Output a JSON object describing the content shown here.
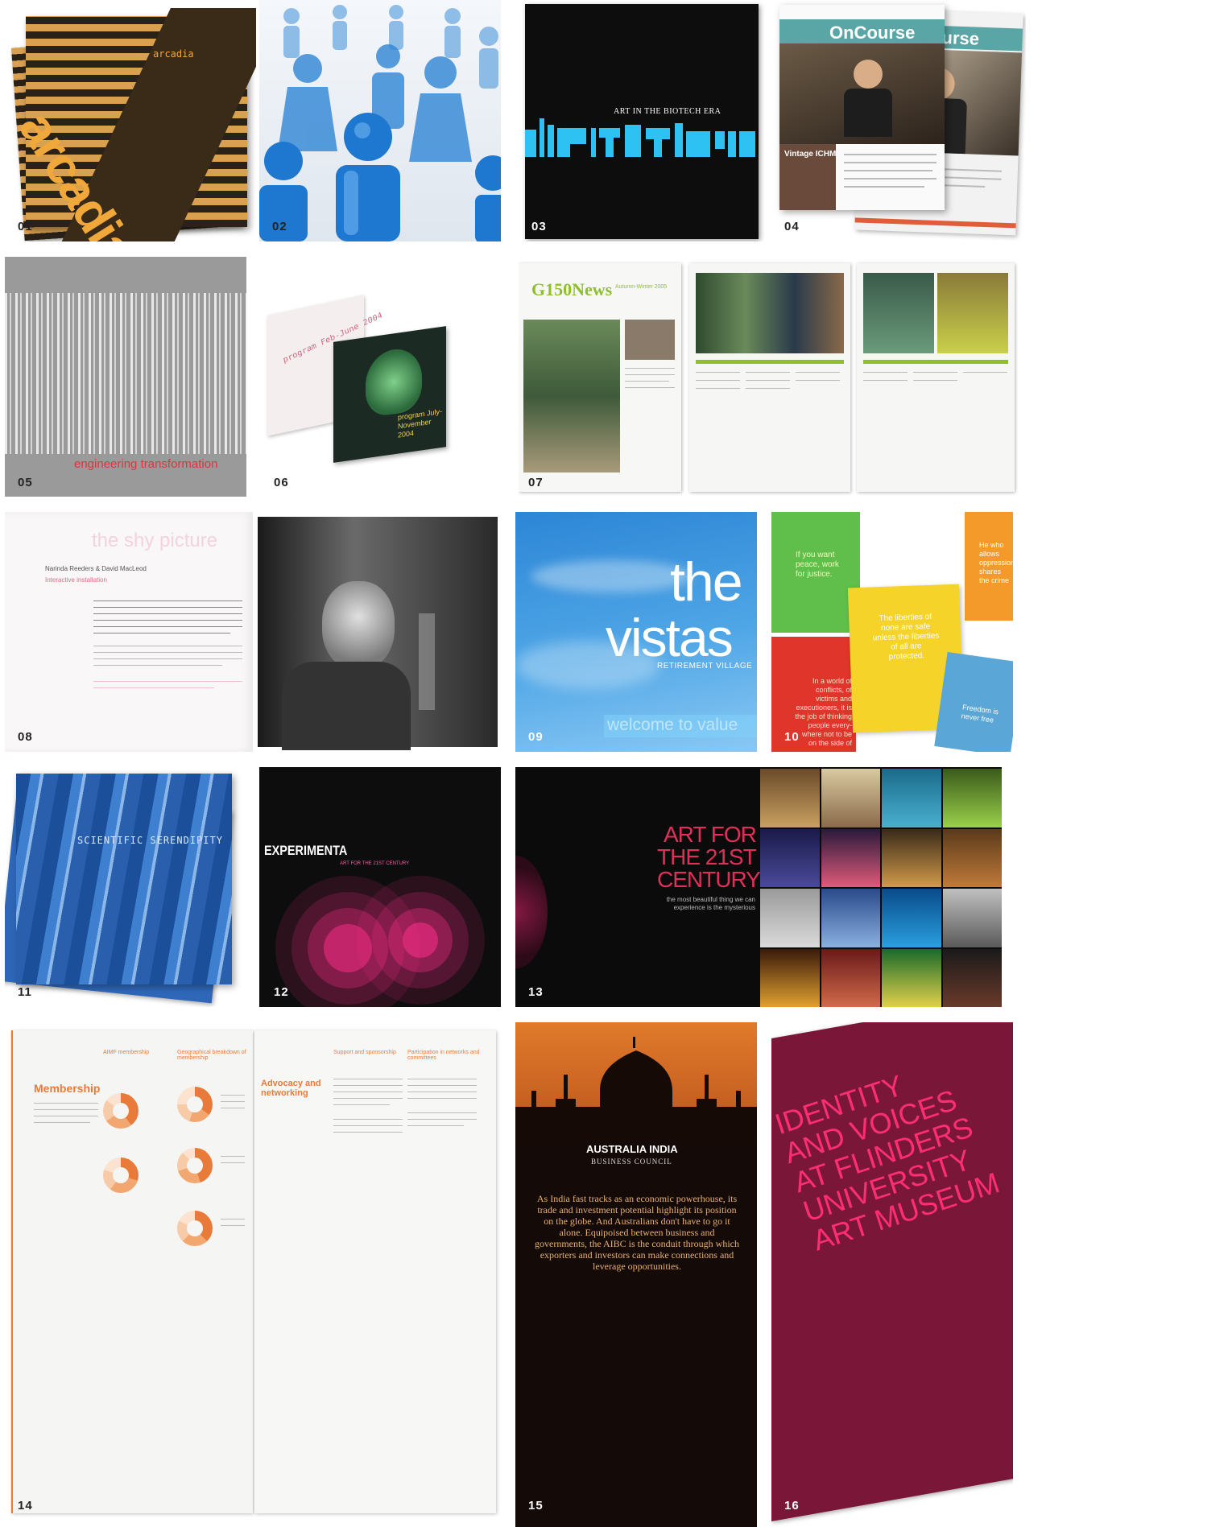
{
  "tiles": {
    "t01": {
      "num": "01",
      "brand": "arcadia",
      "big": "arcadia"
    },
    "t02": {
      "num": "02"
    },
    "t03": {
      "num": "03",
      "title": "ART IN THE BIOTECH ERA"
    },
    "t04": {
      "num": "04",
      "mast": "OnCourse",
      "mast2": "OnCourse",
      "headline": "Vintage ICHM"
    },
    "t05": {
      "num": "05",
      "tagline": "engineering transformation"
    },
    "t06": {
      "num": "06",
      "card1": "program Feb-June 2004",
      "card2": "program July-November 2004"
    },
    "t07": {
      "num": "07",
      "mast": "G150News",
      "edition": "Autumn-Winter 2005"
    },
    "t08": {
      "num": "08",
      "title": "the shy picture",
      "authors": "Narinda Reeders & David MacLeod",
      "subtitle": "Interactive installation"
    },
    "t09": {
      "num": "09",
      "line1": "the",
      "line2": "vistas",
      "sub": "RETIREMENT VILLAGE",
      "tag": "welcome to value"
    },
    "t10": {
      "num": "10",
      "card_green": "If you want peace, work for justice.",
      "card_yellow": "The liberties of none are safe unless the liberties of all are protected.",
      "card_red": "In a world of conflicts, of victims and executioners, it is the job of thinking people every-where not to be on the side of",
      "card_orange": "He who allows oppression shares the crime",
      "card_blue": "Freedom is never free"
    },
    "t11": {
      "num": "11",
      "title": "SCIENTIFIC SERENDIPITY"
    },
    "t12": {
      "num": "12",
      "title": "EXPERIMENTA",
      "sub": "ART FOR THE 21ST CENTURY"
    },
    "t13": {
      "num": "13",
      "l1": "ART FOR",
      "l2": "THE 21ST",
      "l3": "CENTURY",
      "quote": "the most beautiful thing we can experience is the mysterious"
    },
    "t14": {
      "num": "14",
      "heading1": "Membership",
      "heading2": "Advocacy and networking",
      "col1": "AIMF membership",
      "col2": "Geographical breakdown of membership",
      "col3": "Support and sponsorship",
      "col4": "Participation in networks and committees"
    },
    "t15": {
      "num": "15",
      "org": "AUSTRALIA INDIA",
      "org2": "BUSINESS COUNCIL",
      "body": "As India fast tracks as an economic powerhouse, its trade and investment potential highlight its position on the globe. And Australians don't have to go it alone. Equipoised between business and governments, the AIBC is the conduit through which exporters and investors can make connections and leverage opportunities."
    },
    "t16": {
      "num": "16",
      "l1": "IDENTITY",
      "l2": "AND VOICES",
      "l3": "AT FLINDERS",
      "l4": "UNIVERSITY",
      "l5": "ART MUSEUM"
    }
  },
  "colors": {
    "arcadia_orange": "#f0a83a",
    "biotech_blue": "#2ec2f2",
    "pink": "#ff2e8a",
    "oncourse_teal": "#5aa6a6",
    "g150_green": "#8fbf2e",
    "membership_orange": "#e87b3a",
    "flinders_maroon": "#7a1738"
  }
}
